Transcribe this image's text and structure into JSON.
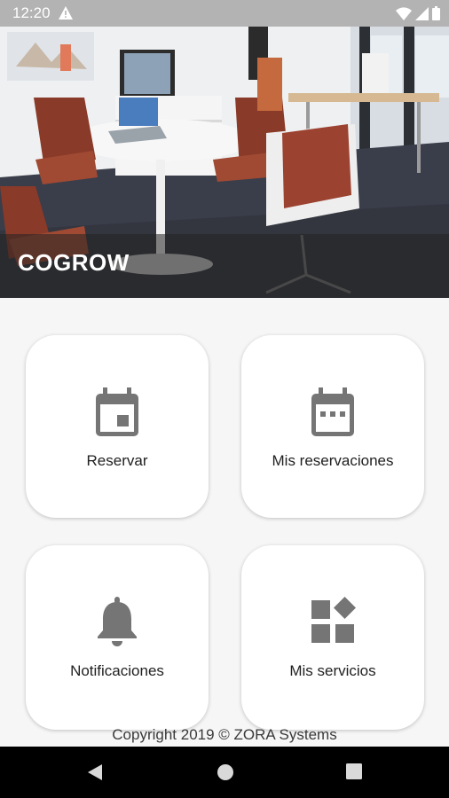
{
  "status_bar": {
    "time": "12:20"
  },
  "hero": {
    "title": "COGROW"
  },
  "menu": [
    {
      "label": "Reservar",
      "icon": "calendar-event-icon"
    },
    {
      "label": "Mis reservaciones",
      "icon": "calendar-dots-icon"
    },
    {
      "label": "Notificaciones",
      "icon": "bell-icon"
    },
    {
      "label": "Mis servicios",
      "icon": "widgets-icon"
    }
  ],
  "footer": {
    "copyright": "Copyright 2019 © ZORA Systems"
  },
  "colors": {
    "icon": "#757575",
    "status_bar": "#b3b3b3",
    "nav_bar": "#000000"
  }
}
